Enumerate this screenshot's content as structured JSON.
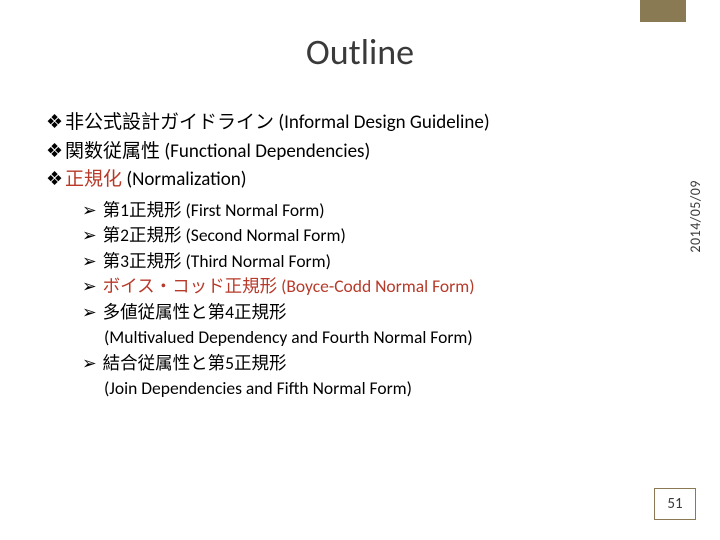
{
  "title": "Outline",
  "date": "2014/05/09",
  "page_number": "51",
  "bullets": {
    "b1_jp": "非公式設計ガイドライン",
    "b1_en": " (Informal Design Guideline)",
    "b2_jp": "関数従属性",
    "b2_en": " (Functional Dependencies)",
    "b3_jp": "正規化",
    "b3_en": " (Normalization)"
  },
  "sub": {
    "s1": "第1正規形 (First Normal Form)",
    "s2": "第2正規形 (Second Normal Form)",
    "s3": "第3正規形 (Third Normal Form)",
    "s4": "ボイス・コッド正規形 (Boyce-Codd Normal Form)",
    "s5": "多値従属性と第4正規形",
    "s5b": "(Multivalued Dependency and Fourth Normal Form)",
    "s6": "結合従属性と第5正規形",
    "s6b": "(Join Dependencies and Fifth Normal Form)"
  },
  "marks": {
    "diamond": "❖",
    "arrow": "➢"
  }
}
